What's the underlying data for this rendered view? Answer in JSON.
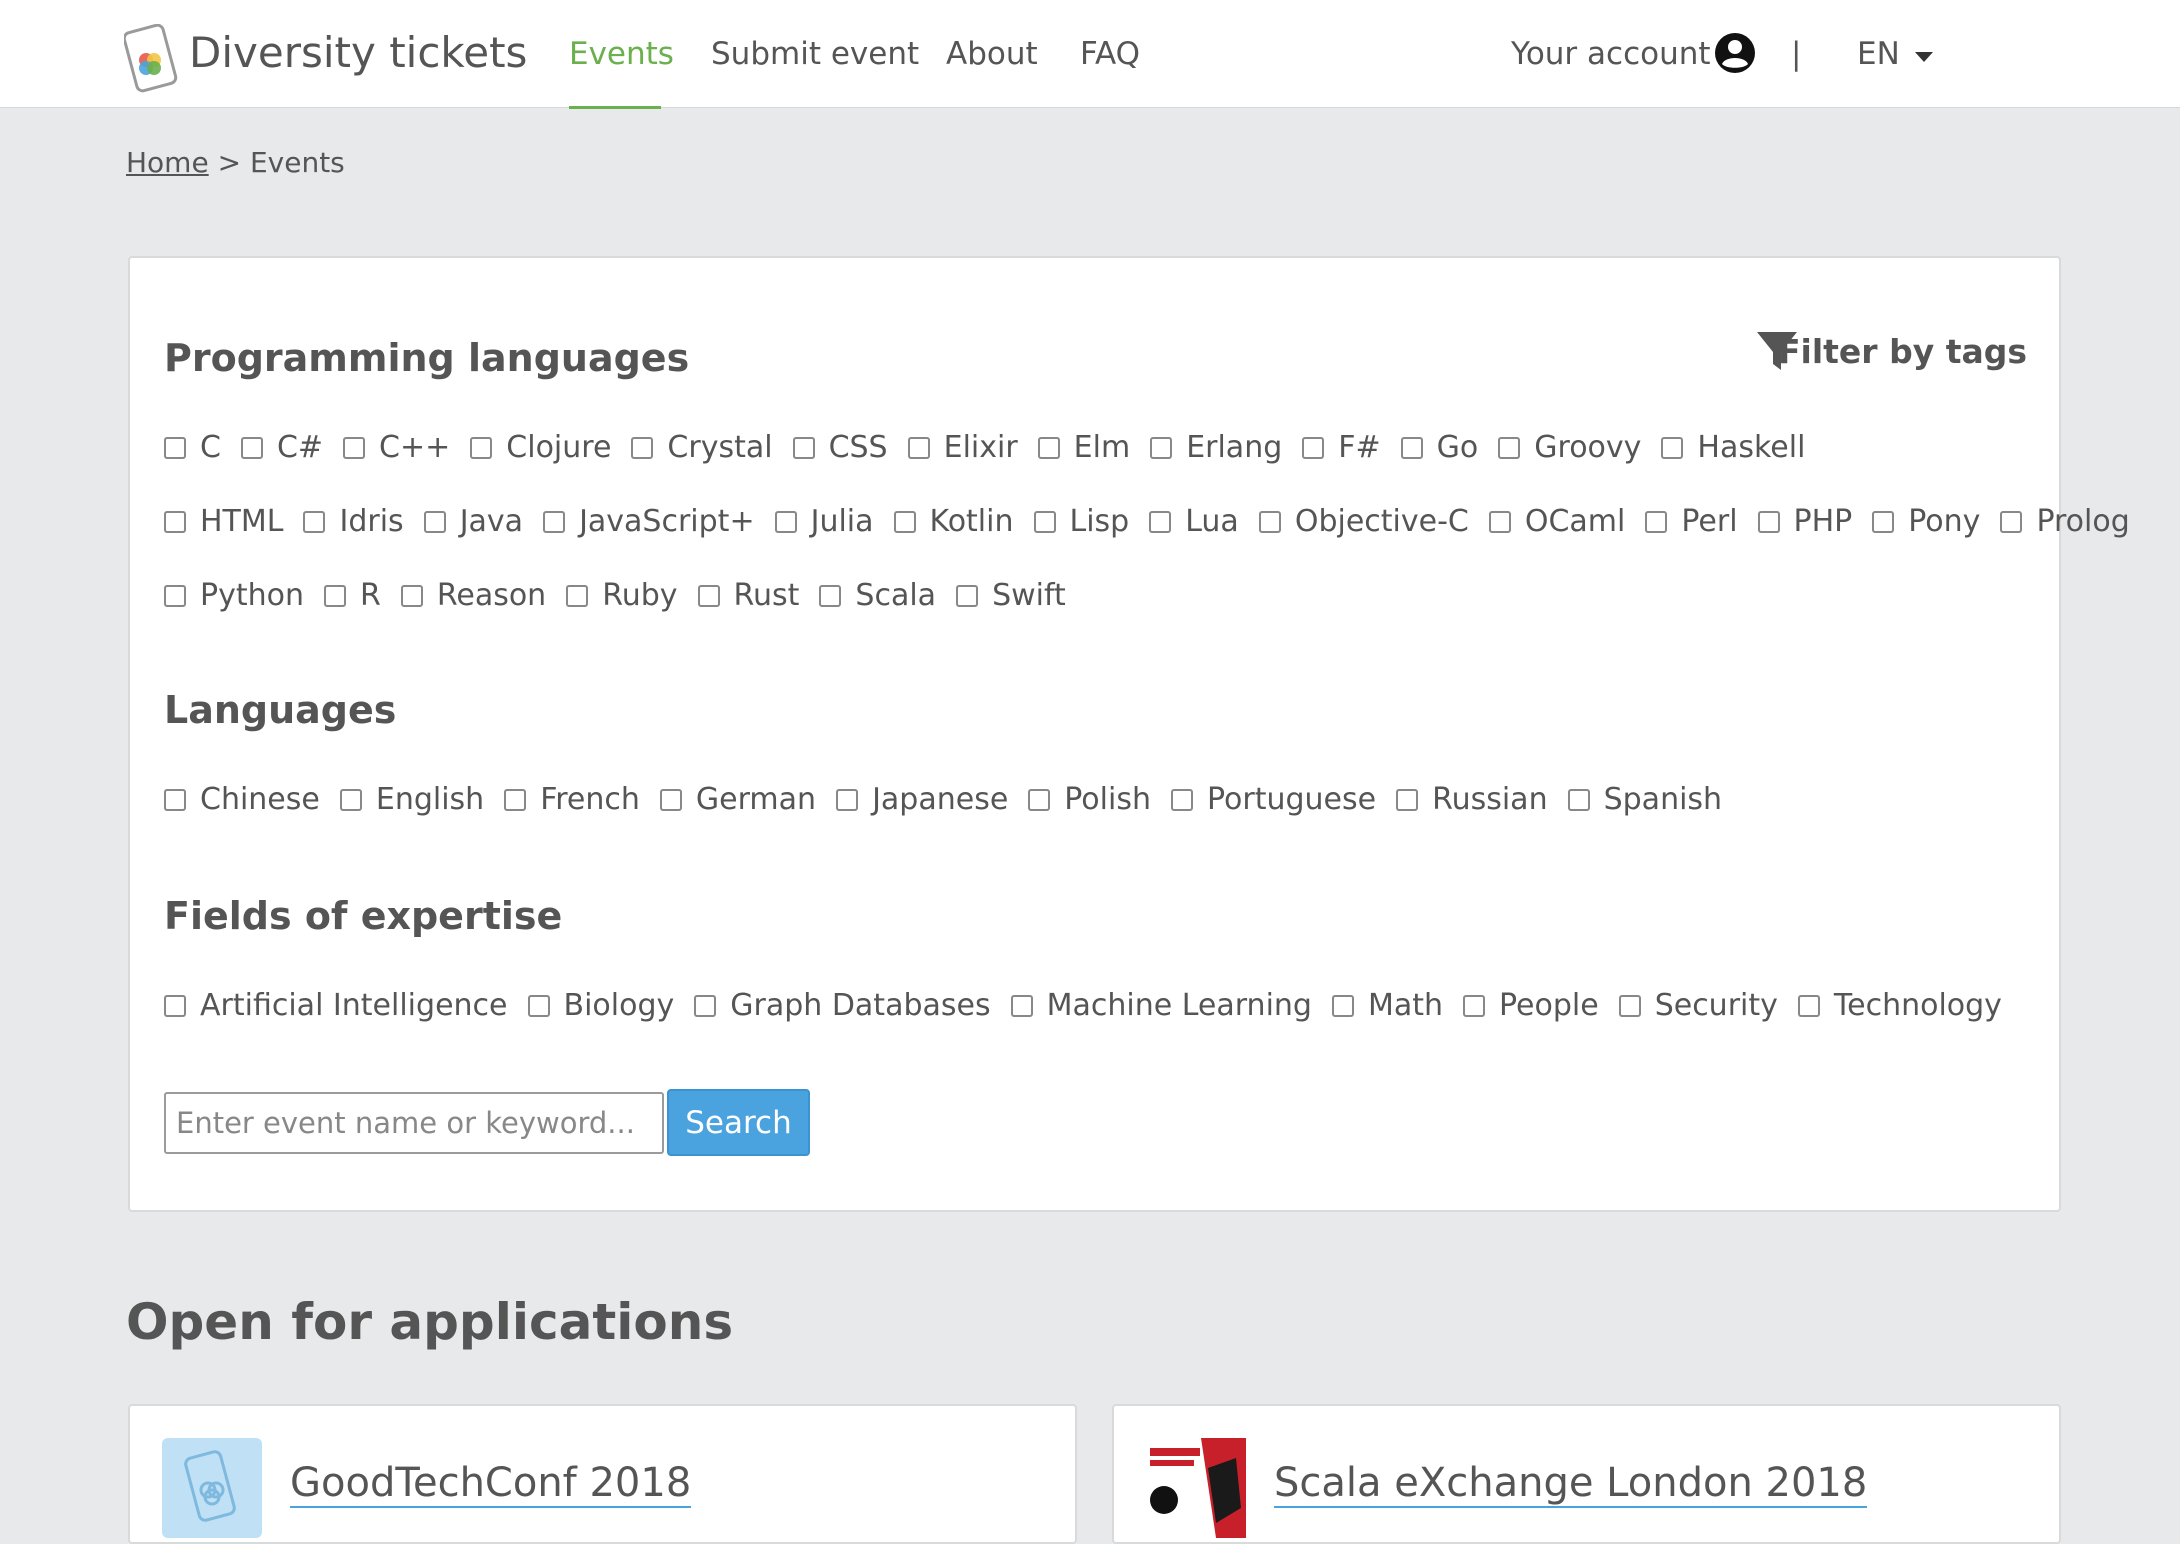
{
  "header": {
    "brand": "Diversity tickets",
    "nav": [
      {
        "label": "Events",
        "active": true
      },
      {
        "label": "Submit event",
        "active": false
      },
      {
        "label": "About",
        "active": false
      },
      {
        "label": "FAQ",
        "active": false
      }
    ],
    "account_label": "Your account",
    "divider": "|",
    "language": "EN"
  },
  "breadcrumb": {
    "home": "Home",
    "separator": " > ",
    "current": "Events"
  },
  "filters": {
    "filter_label": "Filter by tags",
    "programming_languages": {
      "title": "Programming languages",
      "rows": [
        [
          "C",
          "C#",
          "C++",
          "Clojure",
          "Crystal",
          "CSS",
          "Elixir",
          "Elm",
          "Erlang",
          "F#",
          "Go",
          "Groovy",
          "Haskell"
        ],
        [
          "HTML",
          "Idris",
          "Java",
          "JavaScript+",
          "Julia",
          "Kotlin",
          "Lisp",
          "Lua",
          "Objective-C",
          "OCaml",
          "Perl",
          "PHP",
          "Pony",
          "Prolog"
        ],
        [
          "Python",
          "R",
          "Reason",
          "Ruby",
          "Rust",
          "Scala",
          "Swift"
        ]
      ]
    },
    "languages": {
      "title": "Languages",
      "items": [
        "Chinese",
        "English",
        "French",
        "German",
        "Japanese",
        "Polish",
        "Portuguese",
        "Russian",
        "Spanish"
      ]
    },
    "fields_of_expertise": {
      "title": "Fields of expertise",
      "items": [
        "Artificial Intelligence",
        "Biology",
        "Graph Databases",
        "Machine Learning",
        "Math",
        "People",
        "Security",
        "Technology"
      ]
    },
    "search": {
      "placeholder": "Enter event name or keyword...",
      "value": "",
      "button": "Search"
    }
  },
  "open_for_applications": {
    "heading": "Open for applications",
    "events": [
      {
        "title": "GoodTechConf 2018",
        "thumb": "diversity-tickets-logo"
      },
      {
        "title": "Scala eXchange London 2018",
        "thumb": "scala-exchange-poster"
      }
    ]
  },
  "colors": {
    "accent_green": "#6ab04c",
    "button_blue": "#4aa3df",
    "page_bg": "#e8e9eb",
    "text": "#555555"
  }
}
